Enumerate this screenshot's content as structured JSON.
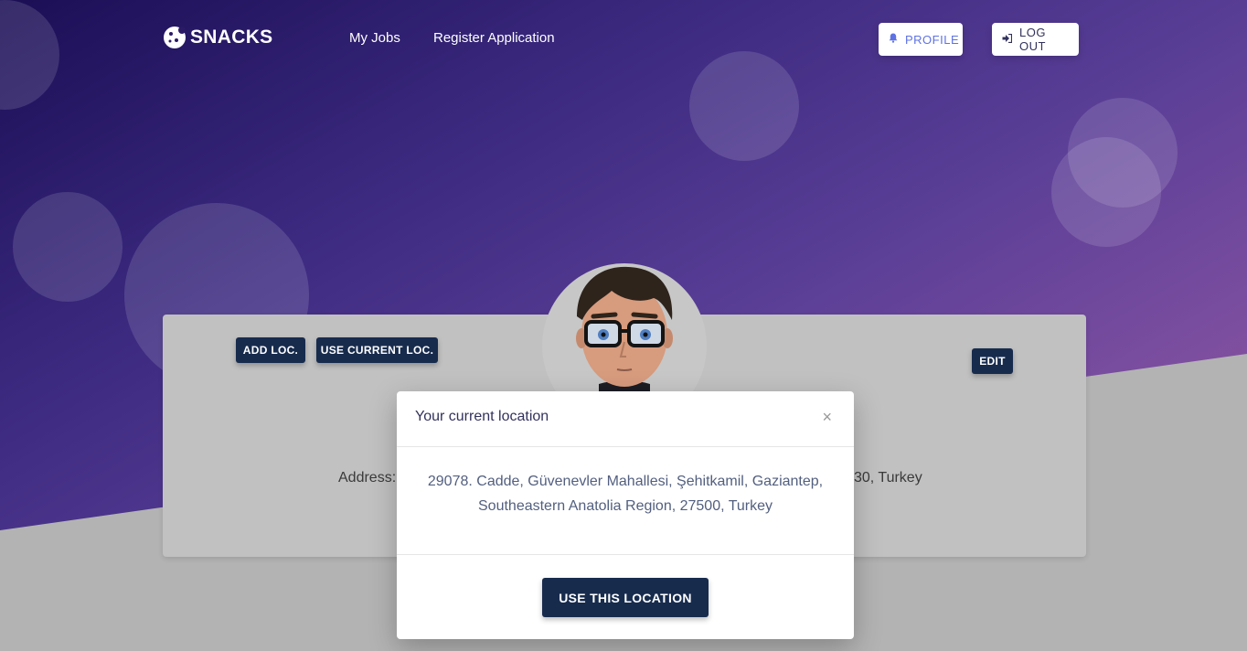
{
  "brand": {
    "name": "SNACKS",
    "logo_icon": "cookie-icon"
  },
  "nav": {
    "links": [
      "My Jobs",
      "Register Application"
    ],
    "profile_label": "PROFILE",
    "profile_icon": "bell-icon",
    "logout_label": "LOG OUT",
    "logout_icon": "sign-out-icon"
  },
  "card": {
    "add_loc_label": "ADD LOC.",
    "use_current_loc_label": "USE CURRENT LOC.",
    "edit_label": "EDIT",
    "address_label": "Address:",
    "address_tail": "30, Turkey"
  },
  "modal": {
    "title": "Your current location",
    "close_symbol": "×",
    "address_line1": "29078. Cadde, Güvenevler Mahallesi, Şehitkamil, Gaziantep,",
    "address_line2": "Southeastern Anatolia Region, 27500, Turkey",
    "use_button_label": "USE THIS LOCATION"
  },
  "colors": {
    "primary_dark": "#172b4d",
    "accent": "#5e72e4",
    "hero_start": "#1b0e55",
    "hero_end": "#a05b9c"
  }
}
